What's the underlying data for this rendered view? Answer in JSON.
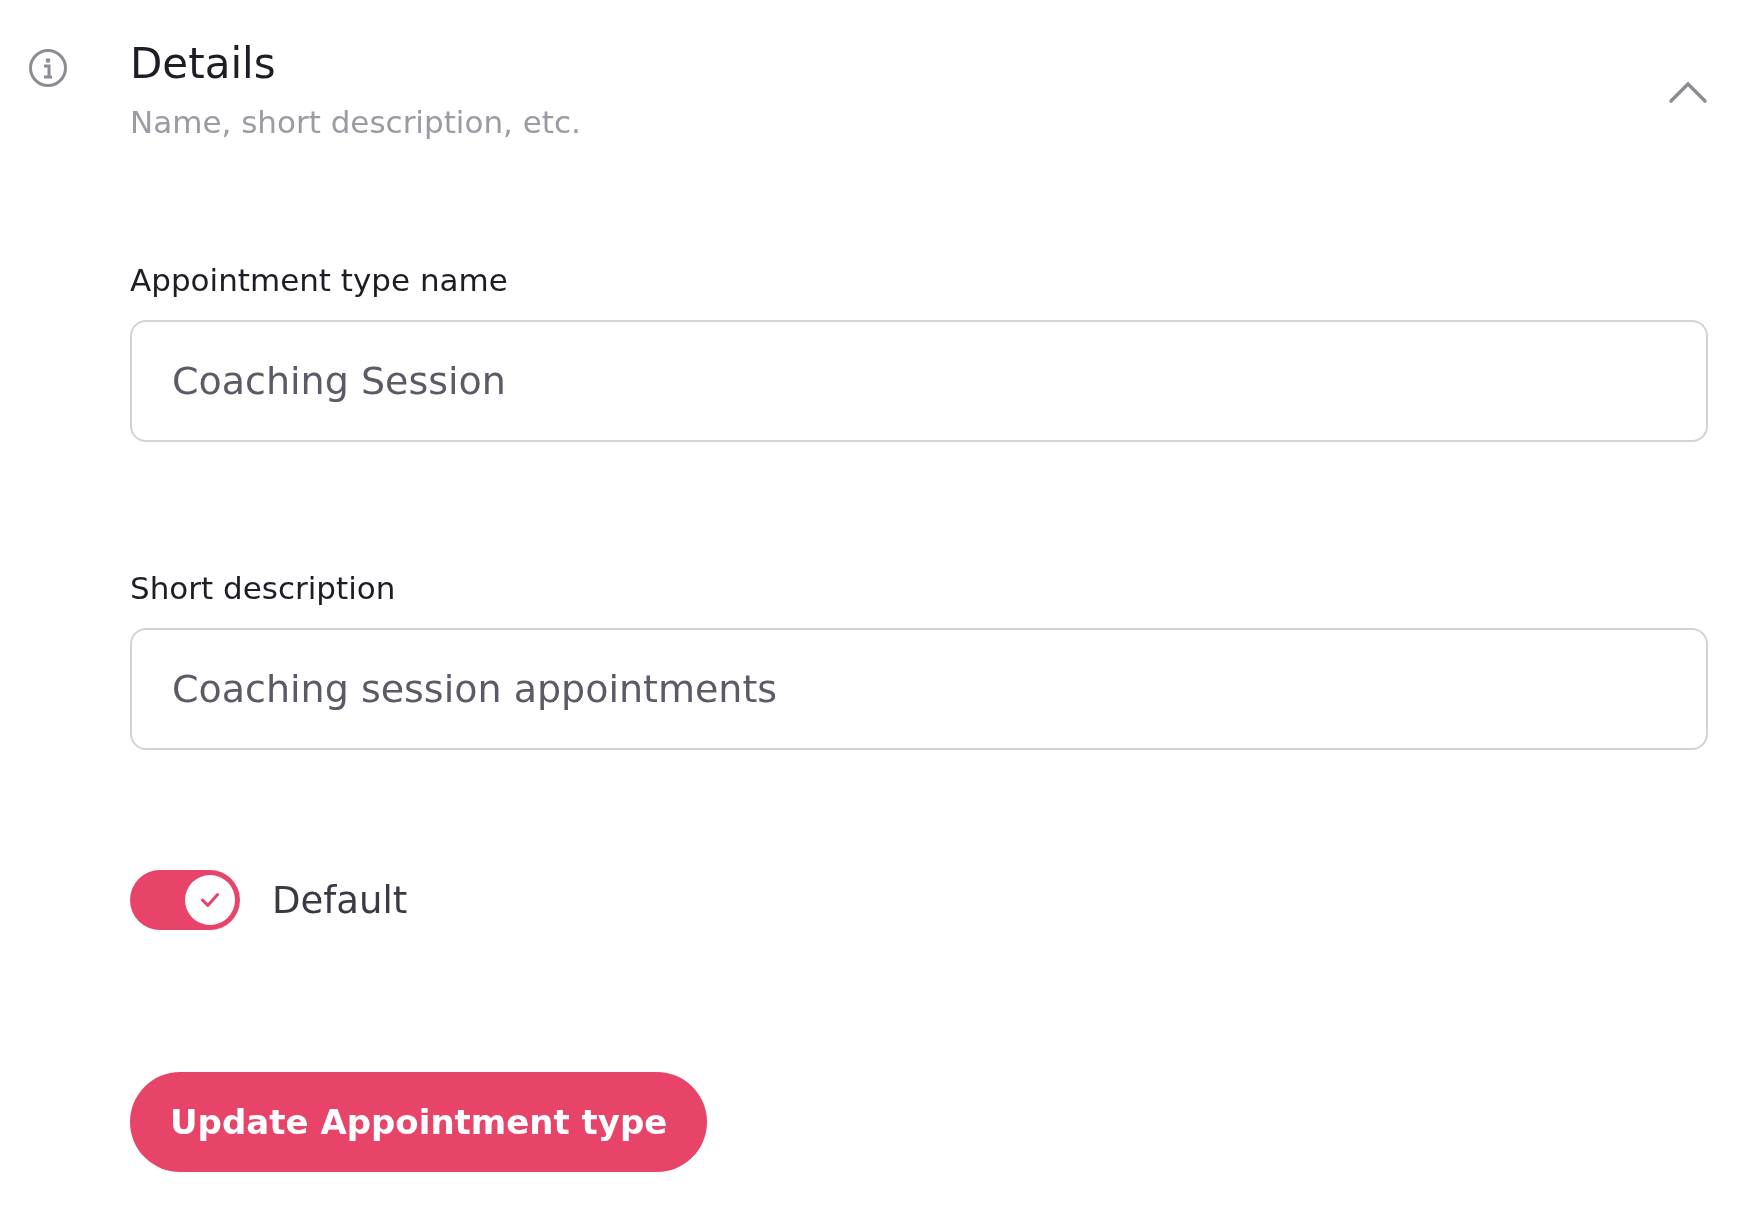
{
  "section": {
    "title": "Details",
    "subtitle": "Name, short description, etc.",
    "expanded": true
  },
  "fields": [
    {
      "label": "Appointment type name",
      "value": "Coaching Session"
    },
    {
      "label": "Short description",
      "value": "Coaching session appointments"
    }
  ],
  "toggle": {
    "label": "Default",
    "on": true
  },
  "button": {
    "label": "Update Appointment type"
  }
}
